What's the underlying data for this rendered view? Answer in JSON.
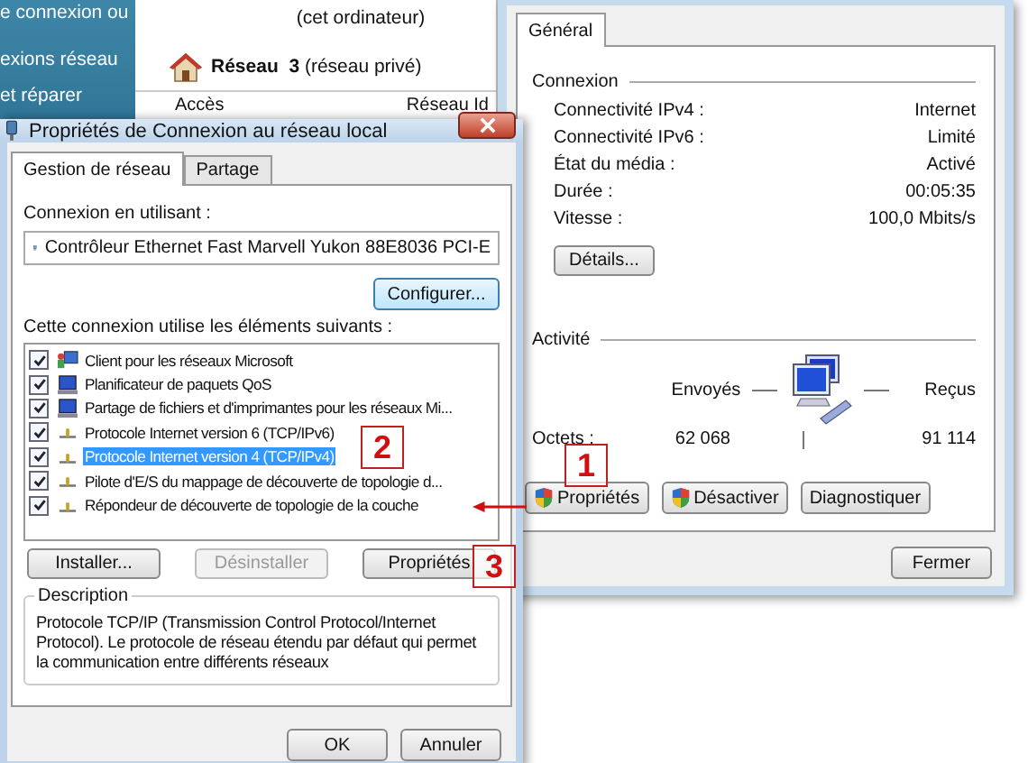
{
  "background_window": {
    "sidebar_links": [
      "e connexion ou",
      "exions réseau",
      "et réparer"
    ],
    "computer_caption": "(cet ordinateur)",
    "network_name": "Réseau",
    "network_number": "3",
    "network_type": "(réseau privé)",
    "column_1": "Accès",
    "column_2": "Réseau Id"
  },
  "status_dialog": {
    "tabs": [
      {
        "label": "Général",
        "selected": true
      }
    ],
    "connection_heading": "Connexion",
    "connection_rows": [
      {
        "label": "Connectivité IPv4 :",
        "value": "Internet"
      },
      {
        "label": "Connectivité IPv6 :",
        "value": "Limité"
      },
      {
        "label": "État du média :",
        "value": "Activé"
      },
      {
        "label": "Durée :",
        "value": "00:05:35"
      },
      {
        "label": "Vitesse :",
        "value": "100,0 Mbits/s"
      }
    ],
    "details_button": "Détails...",
    "activity_heading": "Activité",
    "sent_label": "Envoyés",
    "received_label": "Reçus",
    "bytes_label": "Octets :",
    "bytes_sent": "62 068",
    "bytes_received": "91 114",
    "buttons": [
      {
        "label": "Propriétés",
        "shield": true
      },
      {
        "label": "Désactiver",
        "shield": true
      },
      {
        "label": "Diagnostiquer",
        "shield": false
      }
    ],
    "close_button": "Fermer"
  },
  "properties_dialog": {
    "title": "Propriétés de Connexion au réseau local",
    "tabs": [
      {
        "label": "Gestion de réseau",
        "selected": true
      },
      {
        "label": "Partage",
        "selected": false
      }
    ],
    "connect_using_label": "Connexion en utilisant :",
    "adapter": "Contrôleur Ethernet Fast Marvell Yukon 88E8036 PCI-E",
    "configure_button": "Configurer...",
    "items_label": "Cette connexion utilise les éléments suivants :",
    "items": [
      {
        "label": "Client pour les réseaux Microsoft",
        "kind": "client",
        "checked": true,
        "selected": false
      },
      {
        "label": "Planificateur de paquets QoS",
        "kind": "service",
        "checked": true,
        "selected": false
      },
      {
        "label": "Partage de fichiers et d'imprimantes pour les réseaux Mi...",
        "kind": "service",
        "checked": true,
        "selected": false
      },
      {
        "label": "Protocole Internet version 6 (TCP/IPv6)",
        "kind": "protocol",
        "checked": true,
        "selected": false
      },
      {
        "label": "Protocole Internet version 4 (TCP/IPv4)",
        "kind": "protocol",
        "checked": true,
        "selected": true
      },
      {
        "label": "Pilote d'E/S du mappage de découverte de topologie d...",
        "kind": "protocol",
        "checked": true,
        "selected": false
      },
      {
        "label": "Répondeur de découverte de topologie de la couche",
        "kind": "protocol",
        "checked": true,
        "selected": false
      }
    ],
    "buttons": [
      {
        "label": "Installer...",
        "disabled": false
      },
      {
        "label": "Désinstaller",
        "disabled": true
      },
      {
        "label": "Propriétés",
        "disabled": false
      }
    ],
    "description_heading": "Description",
    "description": "Protocole TCP/IP (Transmission Control Protocol/Internet Protocol). Le protocole de réseau étendu par défaut qui permet la communication entre différents réseaux",
    "ok_button": "OK",
    "cancel_button": "Annuler"
  },
  "annotations": [
    {
      "number": "1"
    },
    {
      "number": "2"
    },
    {
      "number": "3"
    }
  ]
}
